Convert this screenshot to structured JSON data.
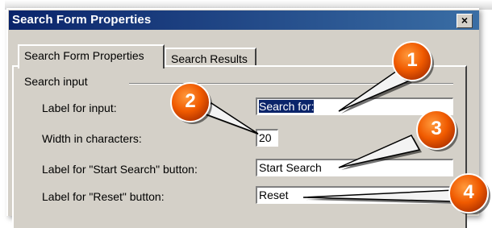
{
  "window": {
    "title": "Search Form Properties",
    "close_glyph": "×"
  },
  "tabs": [
    {
      "label": "Search Form Properties",
      "active": true
    },
    {
      "label": "Search Results",
      "active": false
    }
  ],
  "group": {
    "title": "Search input"
  },
  "fields": {
    "label_for_input": {
      "label": "Label for input:",
      "value": "Search for:"
    },
    "width_chars": {
      "label": "Width in characters:",
      "value": "20"
    },
    "start_label": {
      "label": "Label for \"Start Search\" button:",
      "value": "Start Search"
    },
    "reset_label": {
      "label": "Label for \"Reset\" button:",
      "value": "Reset"
    }
  },
  "callouts": [
    {
      "number": "1",
      "color": "#f05a00"
    },
    {
      "number": "2",
      "color": "#f05a00"
    },
    {
      "number": "3",
      "color": "#f05a00"
    },
    {
      "number": "4",
      "color": "#f05a00"
    }
  ],
  "colors": {
    "titlebar_start": "#0a246a",
    "titlebar_end": "#3a6ea5",
    "dialog_face": "#d4d0c8",
    "selection": "#0a246a"
  }
}
